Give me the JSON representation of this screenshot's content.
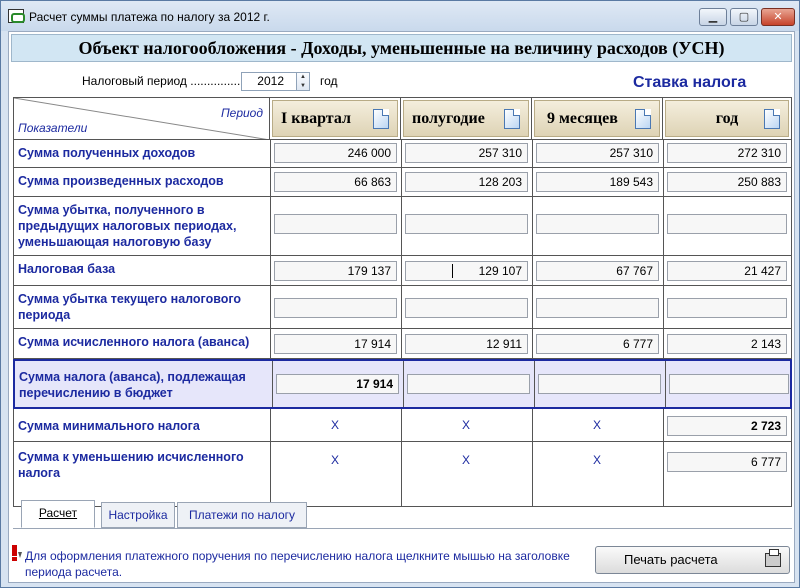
{
  "window": {
    "title": "Расчет суммы платежа по налогу за 2012 г.",
    "min": "▁",
    "max": "▢",
    "close": "✕"
  },
  "heading": "Объект налогообложения - Доходы, уменьшенные на величину расходов (УСН)",
  "period": {
    "label": "Налоговый период ...............",
    "year": "2012",
    "suffix": "год"
  },
  "rate_label": "Ставка налога",
  "table": {
    "corner_period": "Период",
    "corner_indicators": "Показатели",
    "columns": [
      "I квартал",
      "полугодие",
      "9 месяцев",
      "год"
    ],
    "rows": [
      {
        "label": "Сумма полученных доходов",
        "values": [
          "246 000",
          "257 310",
          "257 310",
          "272 310"
        ]
      },
      {
        "label": "Сумма произведенных расходов",
        "values": [
          "66 863",
          "128 203",
          "189 543",
          "250 883"
        ]
      },
      {
        "label": "Сумма убытка, полученного в предыдущих налоговых периодах, уменьшающая налоговую базу",
        "values": [
          "",
          "",
          "",
          ""
        ]
      },
      {
        "label": "Налоговая база",
        "values": [
          "179 137",
          "129 107",
          "67 767",
          "21 427"
        ]
      },
      {
        "label": "Сумма убытка текущего налогового периода",
        "values": [
          "",
          "",
          "",
          ""
        ]
      },
      {
        "label": "Сумма исчисленного налога (аванса)",
        "values": [
          "17 914",
          "12 911",
          "6 777",
          "2 143"
        ]
      },
      {
        "label": "Сумма налога (аванса), подлежащая перечислению в бюджет",
        "values": [
          "17 914",
          "",
          "",
          ""
        ]
      },
      {
        "label": "Сумма минимального налога",
        "values": [
          "X",
          "X",
          "X",
          "2 723"
        ]
      },
      {
        "label": "Сумма к уменьшению исчисленного налога",
        "values": [
          "X",
          "X",
          "X",
          "6 777"
        ]
      }
    ]
  },
  "tabs": [
    "Расчет",
    "Настройка",
    "Платежи по налогу"
  ],
  "hint": "Для оформления платежного поручения по перечислению налога щелкните мышью на заголовке периода расчета.",
  "print_button": "Печать расчета"
}
